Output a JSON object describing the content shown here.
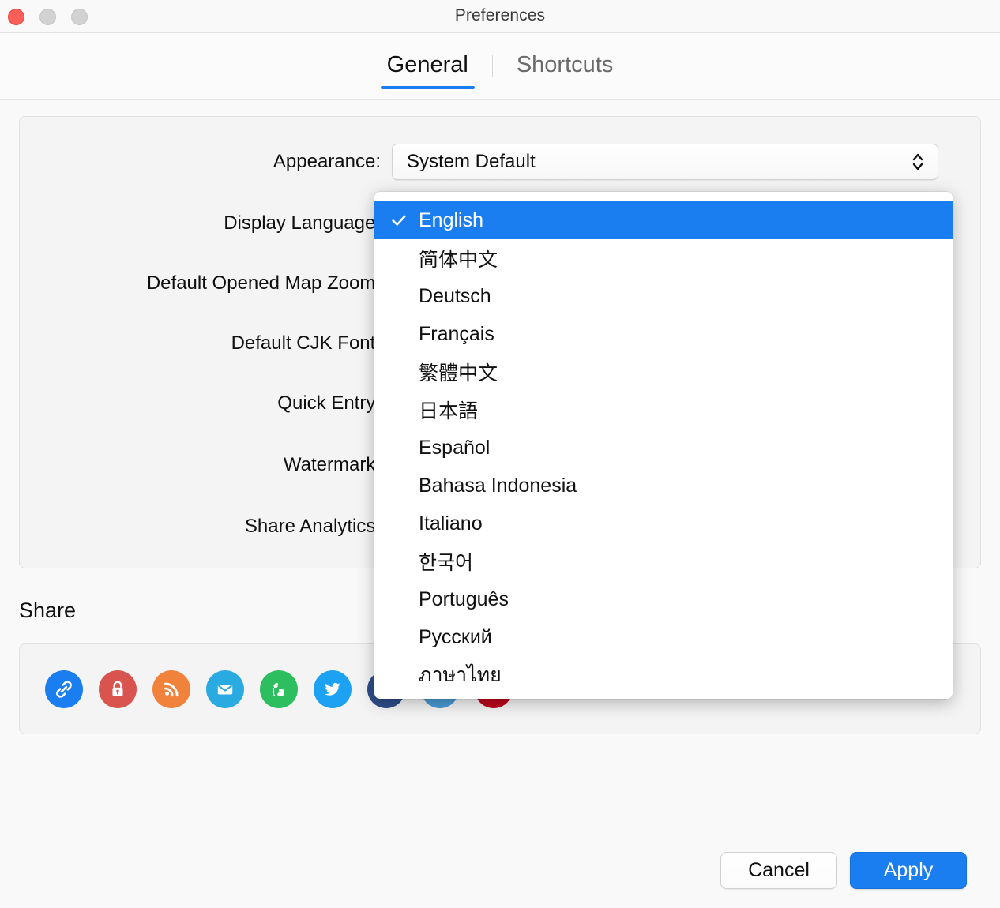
{
  "window": {
    "title": "Preferences",
    "traffic_lights": [
      "close-button",
      "minimize-button",
      "maximize-button"
    ]
  },
  "tabs": [
    {
      "label": "General",
      "active": true
    },
    {
      "label": "Shortcuts",
      "active": false
    }
  ],
  "general": {
    "rows": [
      {
        "label": "Appearance:",
        "value": "System Default"
      },
      {
        "label": "Display Language:",
        "value": "English"
      },
      {
        "label": "Default Opened Map Zoom:",
        "value": ""
      },
      {
        "label": "Default CJK Font:",
        "value": ""
      },
      {
        "label": "Quick Entry:",
        "value": ""
      },
      {
        "label": "Watermark:",
        "value": ""
      },
      {
        "label": "Share Analytics:",
        "value": ""
      }
    ]
  },
  "language_menu": {
    "selected": "English",
    "items": [
      "English",
      "简体中文",
      "Deutsch",
      "Français",
      "繁體中文",
      "日本語",
      "Español",
      "Bahasa Indonesia",
      "Italiano",
      "한국어",
      "Português",
      "Русский",
      "ภาษาไทย"
    ]
  },
  "share": {
    "heading": "Share",
    "items": [
      {
        "name": "copy-link-icon",
        "color": "#1a7ef0"
      },
      {
        "name": "lock-icon",
        "color": "#d9534f"
      },
      {
        "name": "rss-icon",
        "color": "#f0823c"
      },
      {
        "name": "email-icon",
        "color": "#29aae1"
      },
      {
        "name": "evernote-icon",
        "color": "#2dbe60"
      },
      {
        "name": "twitter-icon",
        "color": "#1da1f2"
      },
      {
        "name": "facebook-icon",
        "color": "#2e4d8a"
      },
      {
        "name": "linkedin-icon",
        "color": "#4a9bd4"
      },
      {
        "name": "pinterest-icon",
        "color": "#bd081c"
      }
    ]
  },
  "footer": {
    "cancel_label": "Cancel",
    "apply_label": "Apply"
  },
  "colors": {
    "accent": "#1a7ef0",
    "window_bg": "#f9f9f9",
    "group_bg": "#f4f4f4"
  }
}
